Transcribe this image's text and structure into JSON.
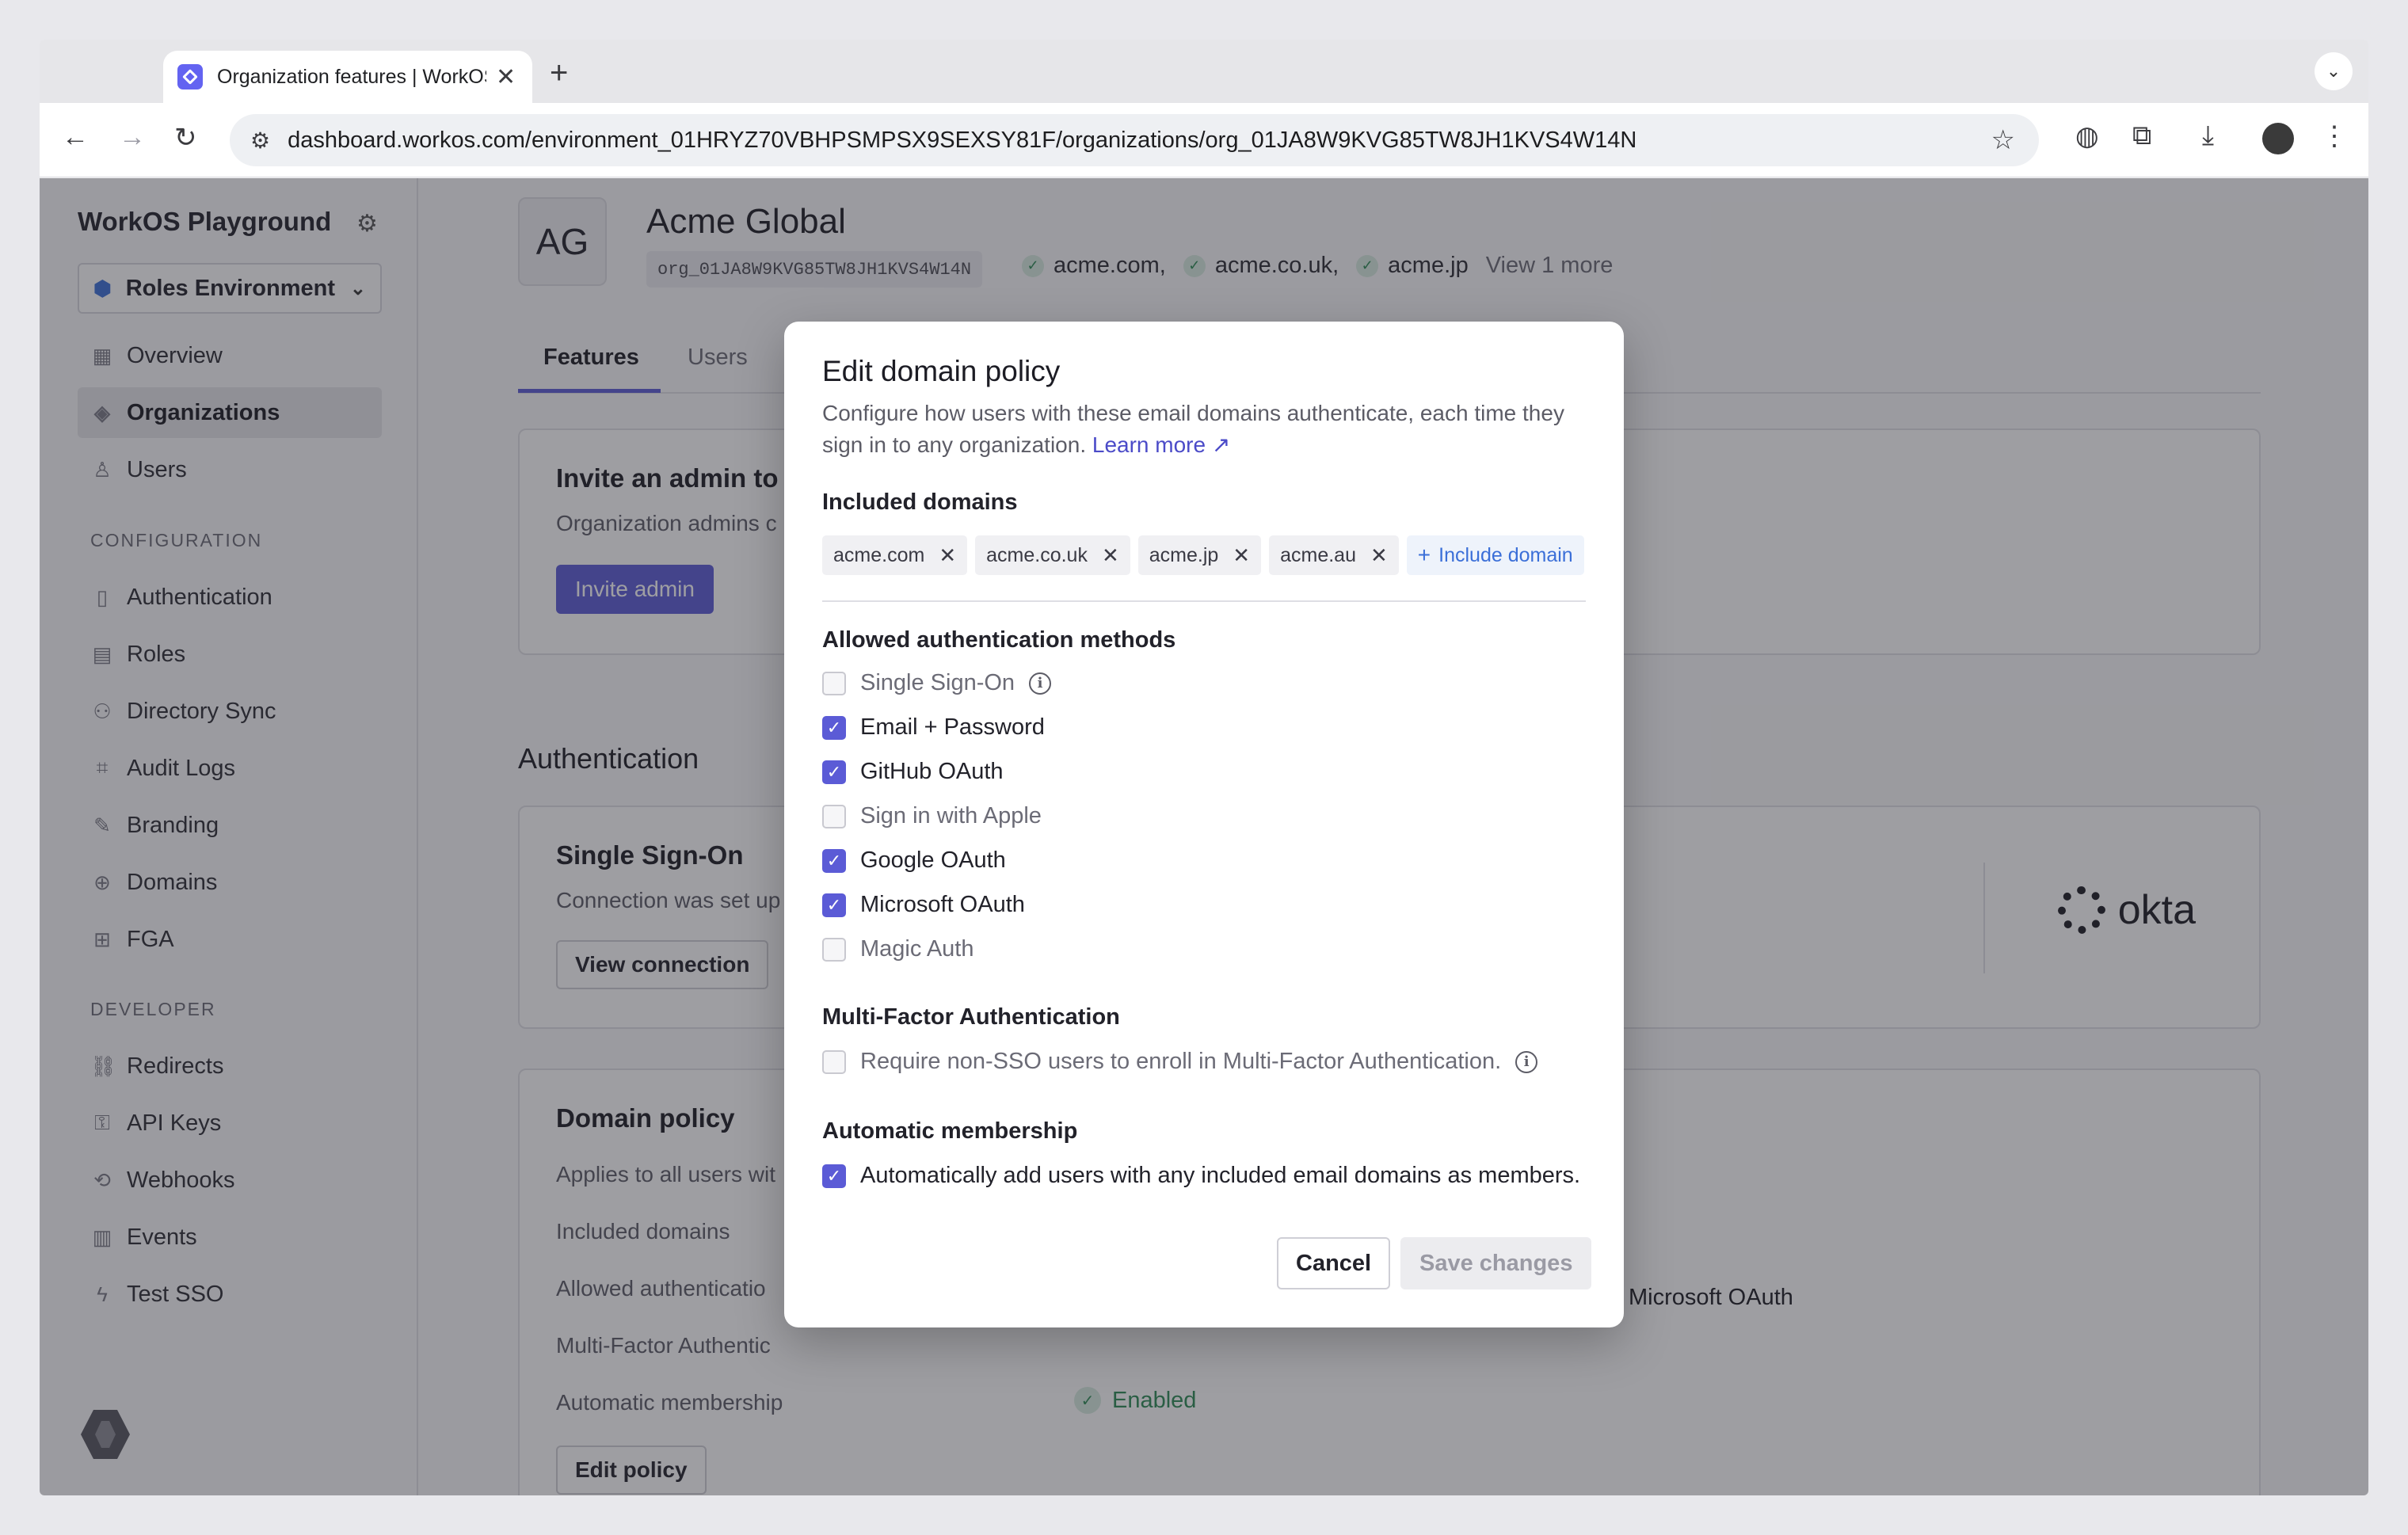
{
  "browser": {
    "tab_title": "Organization features | WorkOS",
    "url": "dashboard.workos.com/environment_01HRYZ70VBHPSMPSX9SEXSY81F/organizations/org_01JA8W9KVG85TW8JH1KVS4W14N",
    "new_tab": "+",
    "close_tab": "✕"
  },
  "sidebar": {
    "workspace": "WorkOS Playground",
    "environment": "Roles Environment",
    "items_main": [
      {
        "label": "Overview",
        "icon": "grid-icon"
      },
      {
        "label": "Organizations",
        "icon": "layers-icon"
      },
      {
        "label": "Users",
        "icon": "user-icon"
      }
    ],
    "configuration_heading": "CONFIGURATION",
    "items_config": [
      {
        "label": "Authentication",
        "icon": "auth-icon"
      },
      {
        "label": "Roles",
        "icon": "roles-icon"
      },
      {
        "label": "Directory Sync",
        "icon": "directory-icon"
      },
      {
        "label": "Audit Logs",
        "icon": "audit-icon"
      },
      {
        "label": "Branding",
        "icon": "brush-icon"
      },
      {
        "label": "Domains",
        "icon": "globe-icon"
      },
      {
        "label": "FGA",
        "icon": "fga-icon"
      }
    ],
    "developer_heading": "DEVELOPER",
    "items_dev": [
      {
        "label": "Redirects",
        "icon": "link-icon"
      },
      {
        "label": "API Keys",
        "icon": "key-icon"
      },
      {
        "label": "Webhooks",
        "icon": "webhook-icon"
      },
      {
        "label": "Events",
        "icon": "events-icon"
      },
      {
        "label": "Test SSO",
        "icon": "bolt-icon"
      }
    ]
  },
  "org": {
    "initials": "AG",
    "name": "Acme Global",
    "id": "org_01JA8W9KVG85TW8JH1KVS4W14N",
    "domains": [
      "acme.com,",
      "acme.co.uk,",
      "acme.jp"
    ],
    "more": "View 1 more"
  },
  "tabs": [
    "Features",
    "Users"
  ],
  "invite_card": {
    "title": "Invite an admin to s",
    "text": "Organization admins c",
    "button": "Invite admin"
  },
  "auth_section": "Authentication",
  "sso_card": {
    "title": "Single Sign-On",
    "text": "Connection was set up",
    "button": "View connection",
    "provider": "okta"
  },
  "policy_card": {
    "title": "Domain policy",
    "text": "Applies to all users wit",
    "rows": [
      "Included domains",
      "Allowed authenticatio",
      "Multi-Factor Authentic",
      "Automatic membership"
    ],
    "ms_oauth": "Microsoft OAuth",
    "enabled": "Enabled",
    "button": "Edit policy"
  },
  "modal": {
    "title": "Edit domain policy",
    "description": "Configure how users with these email domains authenticate, each time they sign in to any organization.",
    "learn_more": "Learn more",
    "included_label": "Included domains",
    "chips": [
      "acme.com",
      "acme.co.uk",
      "acme.jp",
      "acme.au"
    ],
    "include_domain": "Include domain",
    "methods_label": "Allowed authentication methods",
    "methods": [
      {
        "label": "Single Sign-On",
        "checked": false,
        "info": true
      },
      {
        "label": "Email + Password",
        "checked": true
      },
      {
        "label": "GitHub OAuth",
        "checked": true
      },
      {
        "label": "Sign in with Apple",
        "checked": false
      },
      {
        "label": "Google OAuth",
        "checked": true
      },
      {
        "label": "Microsoft OAuth",
        "checked": true
      },
      {
        "label": "Magic Auth",
        "checked": false
      }
    ],
    "mfa_label": "Multi-Factor Authentication",
    "mfa_option": "Require non-SSO users to enroll in Multi-Factor Authentication.",
    "membership_label": "Automatic membership",
    "membership_option": "Automatically add users with any included email domains as members.",
    "cancel": "Cancel",
    "save": "Save changes"
  },
  "colors": {
    "accent": "#5b5bd6",
    "success": "#2c8a55",
    "link": "#4b4bc8"
  }
}
